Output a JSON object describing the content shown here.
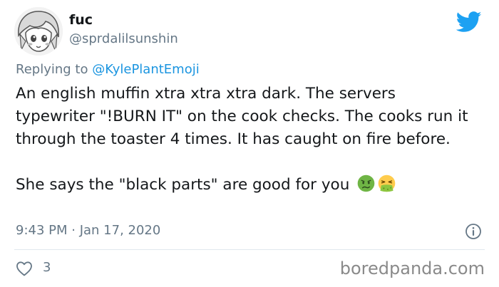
{
  "author": {
    "display_name": "fuc",
    "handle": "@sprdalilsunshin"
  },
  "reply": {
    "prefix": "Replying to",
    "mention": "@KylePlantEmoji"
  },
  "tweet": {
    "paragraph1": "An english muffin xtra xtra xtra dark. The servers typewriter \"!BURN IT\" on the cook checks. The cooks run it through the toaster 4 times. It has caught on fire before.",
    "paragraph2": "She says the \"black parts\" are good for you",
    "emojis": [
      "nauseated-face-emoji",
      "vomiting-face-emoji"
    ]
  },
  "meta": {
    "timestamp": "9:43 PM · Jan 17, 2020"
  },
  "actions": {
    "like_count": "3"
  },
  "watermark": "boredpanda.com",
  "colors": {
    "brand_blue": "#1da1f2",
    "mention_blue": "#1b95e0",
    "muted_text": "#657786",
    "nauseated_green": "#6fb545",
    "vomit_green": "#8dc63f"
  }
}
